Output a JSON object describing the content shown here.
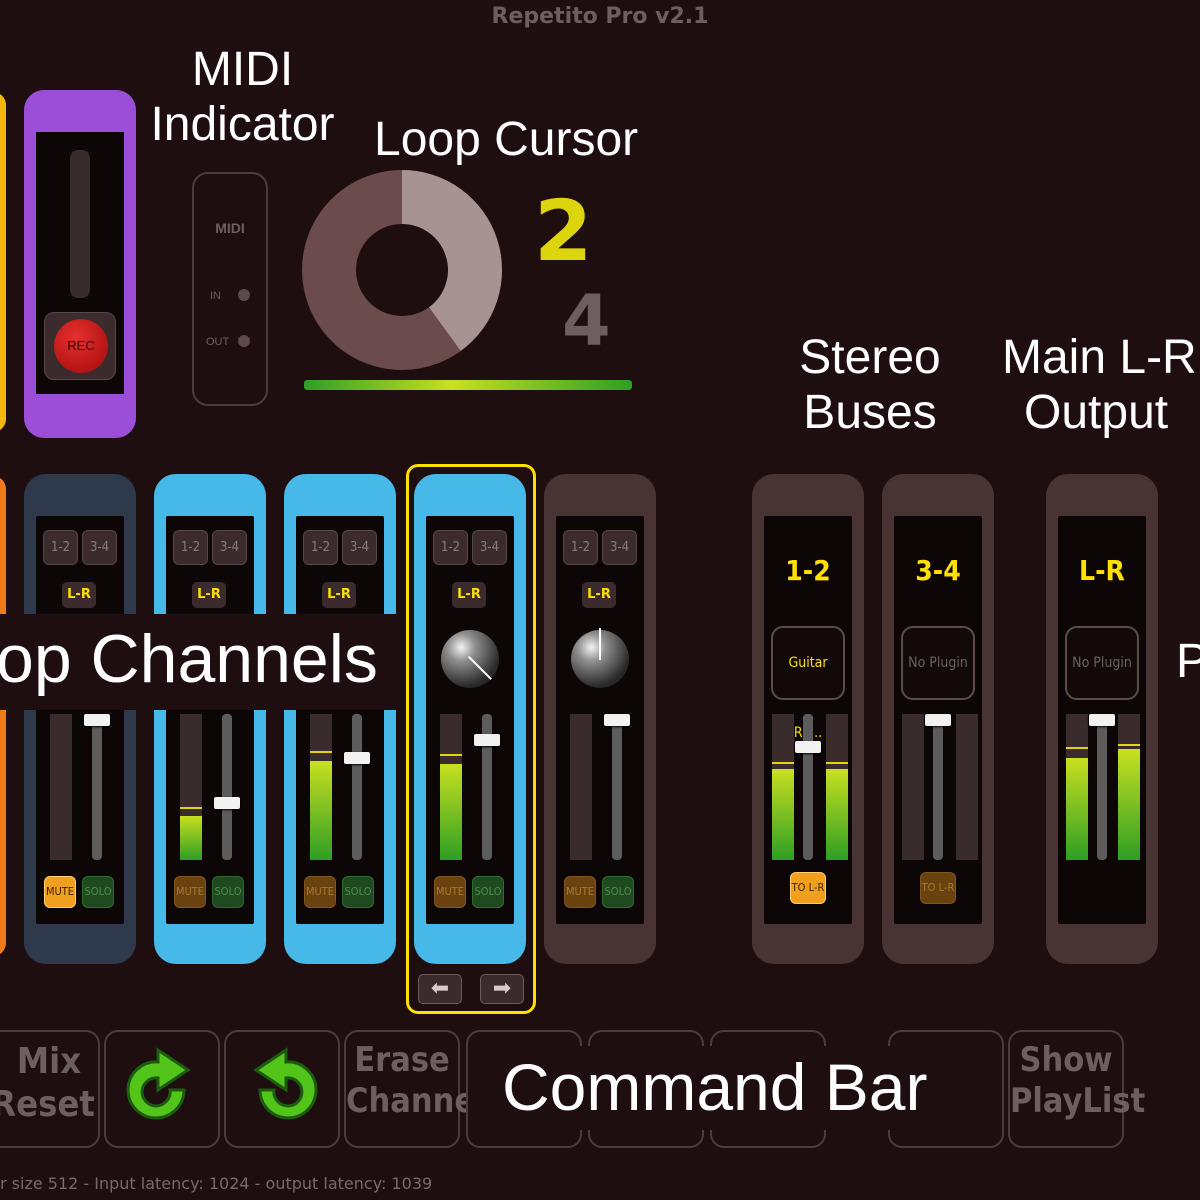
{
  "window": {
    "title": "Repetito Pro v2.1"
  },
  "annotations": {
    "midi_indicator": [
      "MIDI",
      "Indicator"
    ],
    "loop_cursor": "Loop Cursor",
    "stereo_buses": [
      "Stereo",
      "Buses"
    ],
    "main_output": [
      "Main L-R",
      "Output"
    ],
    "loop_channels": "op Channels",
    "command_bar": "Command Bar",
    "cut_right": "P"
  },
  "record": {
    "button_label": "REC"
  },
  "midi": {
    "title": "MIDI",
    "in_label": "IN",
    "out_label": "OUT"
  },
  "loop_cursor": {
    "current": "2",
    "total": "4",
    "progress": 0.4
  },
  "channels": [
    {
      "color": "navy",
      "send1": "1-2",
      "send2": "3-4",
      "out": "L-R",
      "knob": false,
      "meter_level": 0.0,
      "fader": 1.0,
      "mute": "MUTE",
      "solo": "SOLO",
      "mute_on": true
    },
    {
      "color": "blue",
      "send1": "1-2",
      "send2": "3-4",
      "out": "L-R",
      "knob": false,
      "meter_level": 0.3,
      "fader": 0.38,
      "mute": "MUTE",
      "solo": "SOLO",
      "mute_on": false
    },
    {
      "color": "blue",
      "send1": "1-2",
      "send2": "3-4",
      "out": "L-R",
      "knob": false,
      "meter_level": 0.68,
      "fader": 0.72,
      "mute": "MUTE",
      "solo": "SOLO",
      "mute_on": false
    },
    {
      "color": "blue",
      "send1": "1-2",
      "send2": "3-4",
      "out": "L-R",
      "knob": true,
      "meter_level": 0.66,
      "fader": 0.85,
      "mute": "MUTE",
      "solo": "SOLO",
      "mute_on": false
    },
    {
      "color": "brown",
      "send1": "1-2",
      "send2": "3-4",
      "out": "L-R",
      "knob": true,
      "meter_level": 0.0,
      "fader": 1.0,
      "mute": "MUTE",
      "solo": "SOLO",
      "mute_on": false
    }
  ],
  "buses": [
    {
      "label": "1-2",
      "plugin": "Guitar Rig..",
      "to_lr": "TO L-R",
      "active": true
    },
    {
      "label": "3-4",
      "plugin": "No Plugin",
      "to_lr": "TO L-R",
      "active": false
    }
  ],
  "main_output": {
    "label": "L-R",
    "plugin": "No Plugin"
  },
  "command_bar": {
    "mix_reset": [
      "Mix",
      "Reset"
    ],
    "erase_channel": [
      "Erase",
      "Channel"
    ],
    "show_playlist": [
      "Show",
      "PlayList"
    ]
  },
  "status_bar": "r size 512 - Input latency: 1024 - output latency: 1039",
  "colors": {
    "background": "#1e0e0f",
    "channel_selected": "#47b9e9",
    "selection_outline": "#ffe000",
    "record_strip": "#9b4fd8",
    "accent_yellow": "#ffe000",
    "meter_green": "#2e9e24"
  }
}
